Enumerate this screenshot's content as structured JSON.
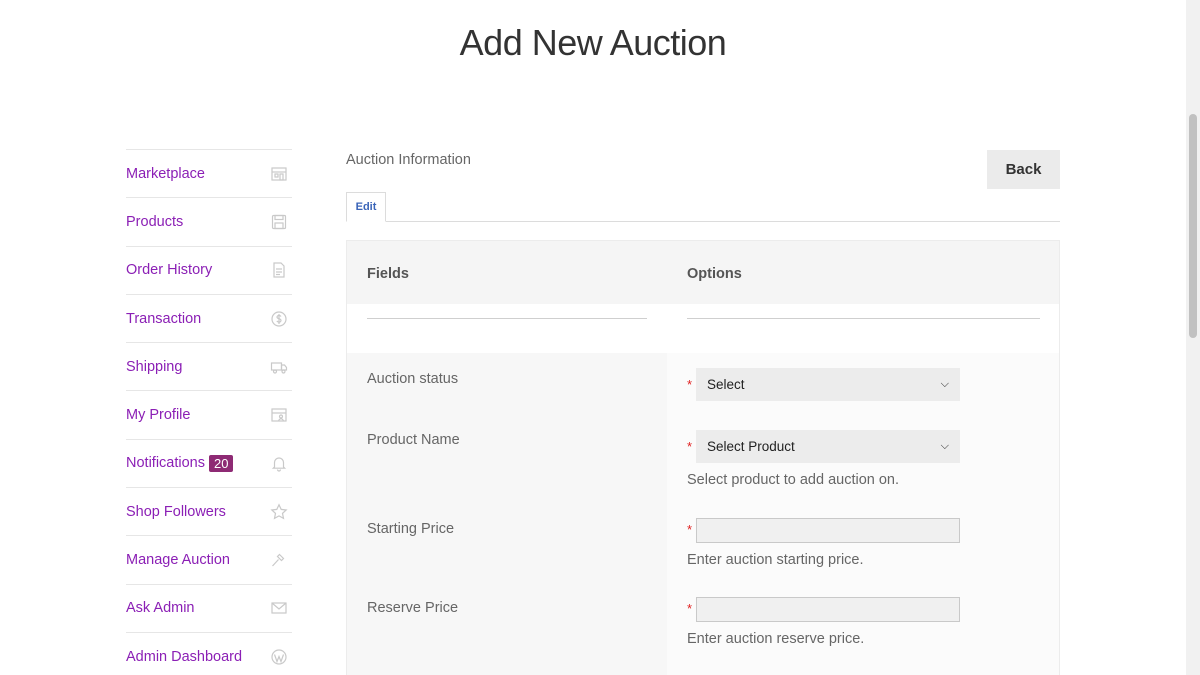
{
  "page_title": "Add New Auction",
  "sidebar": {
    "items": [
      {
        "label": "Marketplace",
        "icon": "store-icon"
      },
      {
        "label": "Products",
        "icon": "floppy-disk-icon"
      },
      {
        "label": "Order History",
        "icon": "document-icon"
      },
      {
        "label": "Transaction",
        "icon": "dollar-circle-icon"
      },
      {
        "label": "Shipping",
        "icon": "truck-icon"
      },
      {
        "label": "My Profile",
        "icon": "profile-store-icon"
      },
      {
        "label": "Notifications",
        "icon": "bell-icon",
        "badge": "20"
      },
      {
        "label": "Shop Followers",
        "icon": "star-icon"
      },
      {
        "label": "Manage Auction",
        "icon": "hammer-icon"
      },
      {
        "label": "Ask Admin",
        "icon": "envelope-icon"
      },
      {
        "label": "Admin Dashboard",
        "icon": "wordpress-icon"
      }
    ]
  },
  "main": {
    "section_title": "Auction Information",
    "back_label": "Back",
    "tab_edit": "Edit",
    "table": {
      "col_fields": "Fields",
      "col_options": "Options"
    },
    "fields": {
      "auction_status": {
        "label": "Auction status",
        "selected": "Select"
      },
      "product_name": {
        "label": "Product Name",
        "selected": "Select Product",
        "help": "Select product to add auction on."
      },
      "starting_price": {
        "label": "Starting Price",
        "value": "",
        "help": "Enter auction starting price."
      },
      "reserve_price": {
        "label": "Reserve Price",
        "value": "",
        "help": "Enter auction reserve price."
      }
    },
    "required_mark": "*"
  },
  "colors": {
    "link": "#8b1fb5",
    "badge": "#8e2a74",
    "required": "#e02020",
    "tab_text": "#3a64b8"
  }
}
